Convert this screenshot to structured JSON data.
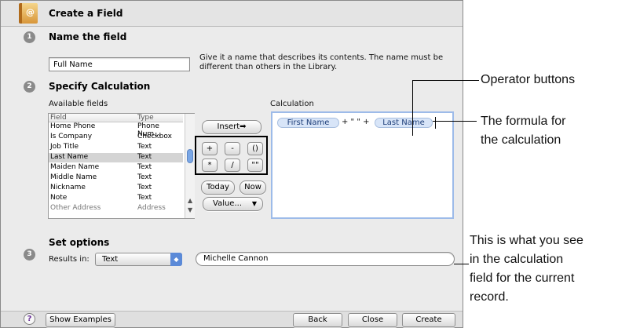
{
  "dialog": {
    "title": "Create a Field",
    "step_numbers": [
      "1",
      "2",
      "3"
    ],
    "name_section": {
      "heading": "Name the field",
      "value": "Full Name",
      "hint": "Give it a name that describes its contents. The name must be different than others in the Library."
    },
    "calc_section": {
      "heading": "Specify Calculation",
      "available_fields_label": "Available fields",
      "calculation_label": "Calculation",
      "columns": [
        "Field",
        "Type"
      ],
      "rows": [
        {
          "field": "Home Phone",
          "type": "Phone Num..."
        },
        {
          "field": "Is Company",
          "type": "Checkbox"
        },
        {
          "field": "Job Title",
          "type": "Text"
        },
        {
          "field": "Last Name",
          "type": "Text"
        },
        {
          "field": "Maiden Name",
          "type": "Text"
        },
        {
          "field": "Middle Name",
          "type": "Text"
        },
        {
          "field": "Nickname",
          "type": "Text"
        },
        {
          "field": "Note",
          "type": "Text"
        },
        {
          "field": "Other Address",
          "type": "Address"
        }
      ],
      "insert_label": "Insert➡",
      "operators": [
        "+",
        "-",
        "()",
        "*",
        "/",
        "\"\""
      ],
      "today_label": "Today",
      "now_label": "Now",
      "value_label": "Value...",
      "formula": {
        "token1": "First Name",
        "separator": "+ \" \" +",
        "token2": "Last Name"
      }
    },
    "options_section": {
      "heading": "Set options",
      "results_label": "Results in:",
      "results_value": "Text",
      "preview": "Michelle Cannon"
    },
    "bottom": {
      "help": "?",
      "show_examples": "Show Examples",
      "back": "Back",
      "close": "Close",
      "create": "Create"
    }
  },
  "annotations": {
    "operators": "Operator buttons",
    "formula_line1": "The formula for",
    "formula_line2": "the calculation",
    "result_line1": "This is what you see",
    "result_line2": "in the calculation",
    "result_line3": "field for the current",
    "result_line4": "record."
  },
  "colors": {
    "accent": "#5b8ad8",
    "token": "#d8e5f8",
    "focus_border": "#9dbbe9"
  }
}
